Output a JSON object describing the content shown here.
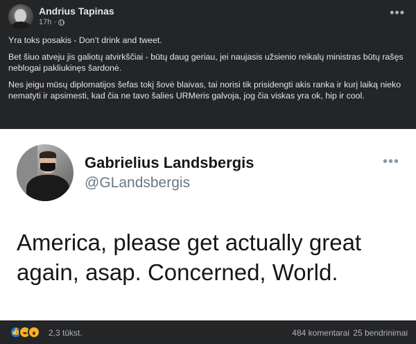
{
  "post": {
    "author": "Andrius Tapinas",
    "time": "17h",
    "separator": "·",
    "paragraphs": [
      "Yra toks posakis - Don’t drink and tweet.",
      "Bet šiuo atveju jis galiotų atvirkščiai - būtų daug geriau, jei naujasis užsienio reikalų ministras būtų rašęs neblogai pakliukinęs šardonė.",
      "Nes jeigu mūsų diplomatijos šefas tokį šovė blaivas, tai norisi tik prisidengti akis ranka ir kurį laiką nieko nematyti ir apsimesti, kad čia ne tavo šalies URMeris galvoja, jog čia viskas yra ok, hip ir cool."
    ],
    "more": "•••"
  },
  "tweet": {
    "name": "Gabrielius Landsbergis",
    "handle": "@GLandsbergis",
    "text": "America, please get actually great again, asap. Concerned, World.",
    "more": "•••"
  },
  "footer": {
    "reactions_count": "2,3 tūkst.",
    "comments": "484 komentarai",
    "shares": "25 bendrinimai",
    "like_glyph": "👍"
  },
  "colors": {
    "fb_dark_bg": "#242526",
    "fb_text": "#e4e6eb",
    "fb_secondary": "#b0b3b8",
    "twitter_handle": "#657786",
    "like_blue": "#1877f2"
  }
}
